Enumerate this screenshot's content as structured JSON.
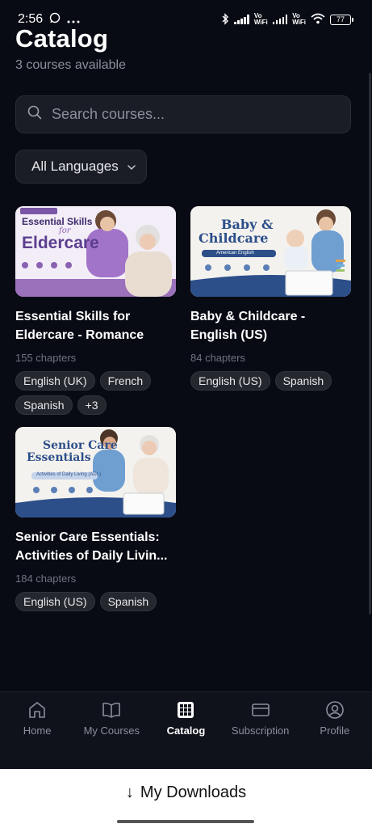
{
  "status_bar": {
    "time": "2:56",
    "battery": "77",
    "vowifi_top": "Vo",
    "vowifi_bottom": "WiFi"
  },
  "header": {
    "title": "Catalog",
    "subtitle": "3 courses available"
  },
  "search": {
    "placeholder": "Search courses..."
  },
  "filter": {
    "selected": "All Languages"
  },
  "courses": [
    {
      "title": "Essential Skills for Eldercare - Romance",
      "chapters": "155 chapters",
      "tags": [
        "English (UK)",
        "French",
        "Spanish",
        "+3"
      ],
      "thumb_title_1": "Essential Skills",
      "thumb_title_2": "for",
      "thumb_title_3": "Eldercare"
    },
    {
      "title": "Baby & Childcare - English (US)",
      "chapters": "84 chapters",
      "tags": [
        "English (US)",
        "Spanish"
      ],
      "thumb_title_1": "Baby &",
      "thumb_title_2": "Childcare",
      "thumb_sub": "American English"
    },
    {
      "title": "Senior Care Essentials: Activities of Daily Livin...",
      "chapters": "184 chapters",
      "tags": [
        "English (US)",
        "Spanish"
      ],
      "thumb_title_1": "Senior Care",
      "thumb_title_2": "Essentials",
      "thumb_sub": "Activities of Daily Living (ADL)"
    }
  ],
  "nav": {
    "items": [
      {
        "label": "Home",
        "icon": "home-icon"
      },
      {
        "label": "My Courses",
        "icon": "book-icon"
      },
      {
        "label": "Catalog",
        "icon": "grid-icon"
      },
      {
        "label": "Subscription",
        "icon": "card-icon"
      },
      {
        "label": "Profile",
        "icon": "user-icon"
      }
    ],
    "active": "Catalog"
  },
  "downloads": {
    "label": "My Downloads",
    "arrow": "↓"
  },
  "colors": {
    "background": "#090b14",
    "surface": "#1b1d26",
    "muted": "#8c8f99"
  }
}
